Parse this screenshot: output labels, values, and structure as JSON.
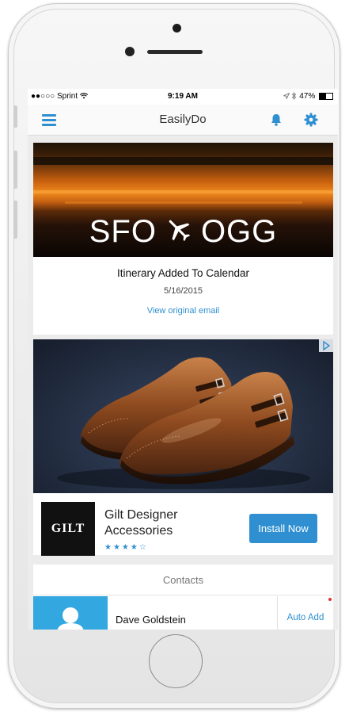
{
  "status_bar": {
    "carrier": "●●○○○ Sprint",
    "time": "9:19 AM",
    "battery": "47%"
  },
  "nav": {
    "title": "EasilyDo"
  },
  "trip_card": {
    "origin": "SFO",
    "destination": "OGG",
    "title": "Itinerary Added To Calendar",
    "date": "5/16/2015",
    "link": "View original email"
  },
  "ad_card": {
    "brand": "GILT",
    "title": "Gilt Designer Accessories",
    "rating_stars": "★★★★☆",
    "cta": "Install Now"
  },
  "contacts_card": {
    "heading": "Contacts",
    "contact_name": "Dave Goldstein",
    "action": "Auto Add"
  },
  "colors": {
    "accent": "#2f8fd0",
    "avatar_bg": "#33a7e0"
  }
}
